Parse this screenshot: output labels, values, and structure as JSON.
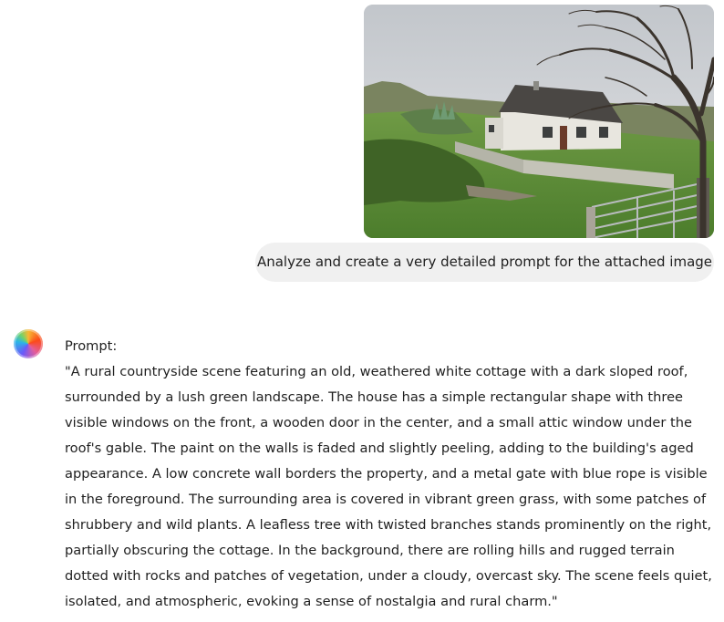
{
  "user_message": {
    "image": {
      "subject": "photo of a white cottage in a green rural landscape with a bare tree and a metal gate"
    },
    "text": "Analyze and create a very detailed prompt for the attached image"
  },
  "assistant_message": {
    "avatar_icon": "assistant-avatar-icon",
    "heading": "Prompt:",
    "body": "\"A rural countryside scene featuring an old, weathered white cottage with a dark sloped roof, surrounded by a lush green landscape. The house has a simple rectangular shape with three visible windows on the front, a wooden door in the center, and a small attic window under the roof's gable. The paint on the walls is faded and slightly peeling, adding to the building's aged appearance. A low concrete wall borders the property, and a metal gate with blue rope is visible in the foreground. The surrounding area is covered in vibrant green grass, with some patches of shrubbery and wild plants. A leafless tree with twisted branches stands prominently on the right, partially obscuring the cottage. In the background, there are rolling hills and rugged terrain dotted with rocks and patches of vegetation, under a cloudy, overcast sky. The scene feels quiet, isolated, and atmospheric, evoking a sense of nostalgia and rural charm.\""
  }
}
